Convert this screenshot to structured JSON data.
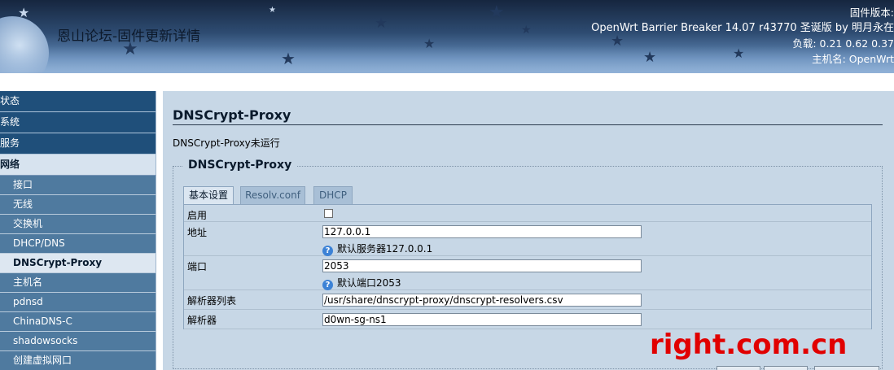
{
  "header": {
    "site_title": "恩山论坛-固件更新详情",
    "firmware_label": "固件版本:",
    "firmware_version": "OpenWrt Barrier Breaker 14.07 r43770 圣诞版 by 明月永在",
    "load": "负载: 0.21 0.62 0.37",
    "hostname": "主机名: OpenWrt"
  },
  "sidebar": {
    "top_items": [
      {
        "label": "状态"
      },
      {
        "label": "系统"
      },
      {
        "label": "服务"
      },
      {
        "label": "网络"
      }
    ],
    "sub_items": [
      {
        "label": "接口"
      },
      {
        "label": "无线"
      },
      {
        "label": "交换机"
      },
      {
        "label": "DHCP/DNS"
      },
      {
        "label": "DNSCrypt-Proxy"
      },
      {
        "label": "主机名"
      },
      {
        "label": "pdnsd"
      },
      {
        "label": "ChinaDNS-C"
      },
      {
        "label": "shadowsocks"
      },
      {
        "label": "创建虚拟网口"
      }
    ]
  },
  "main": {
    "title": "DNSCrypt-Proxy",
    "status": "DNSCrypt-Proxy未运行",
    "section_legend": "DNSCrypt-Proxy",
    "tabs": [
      {
        "label": "基本设置"
      },
      {
        "label": "Resolv.conf"
      },
      {
        "label": "DHCP"
      }
    ],
    "fields": {
      "enable": {
        "label": "启用",
        "checked": false
      },
      "address": {
        "label": "地址",
        "value": "127.0.0.1",
        "help": "默认服务器127.0.0.1"
      },
      "port": {
        "label": "端口",
        "value": "2053",
        "help": "默认端口2053"
      },
      "resolver_list": {
        "label": "解析器列表",
        "value": "/usr/share/dnscrypt-proxy/dnscrypt-resolvers.csv"
      },
      "resolver": {
        "label": "解析器",
        "value": "d0wn-sg-ns1"
      }
    },
    "help_icon": "help-icon"
  },
  "watermark": "right.com.cn",
  "colors": {
    "menu_dark": "#1f4f7a",
    "menu_sub": "#4f7a9f",
    "main_bg": "#c7d7e6",
    "watermark": "#e10000"
  }
}
